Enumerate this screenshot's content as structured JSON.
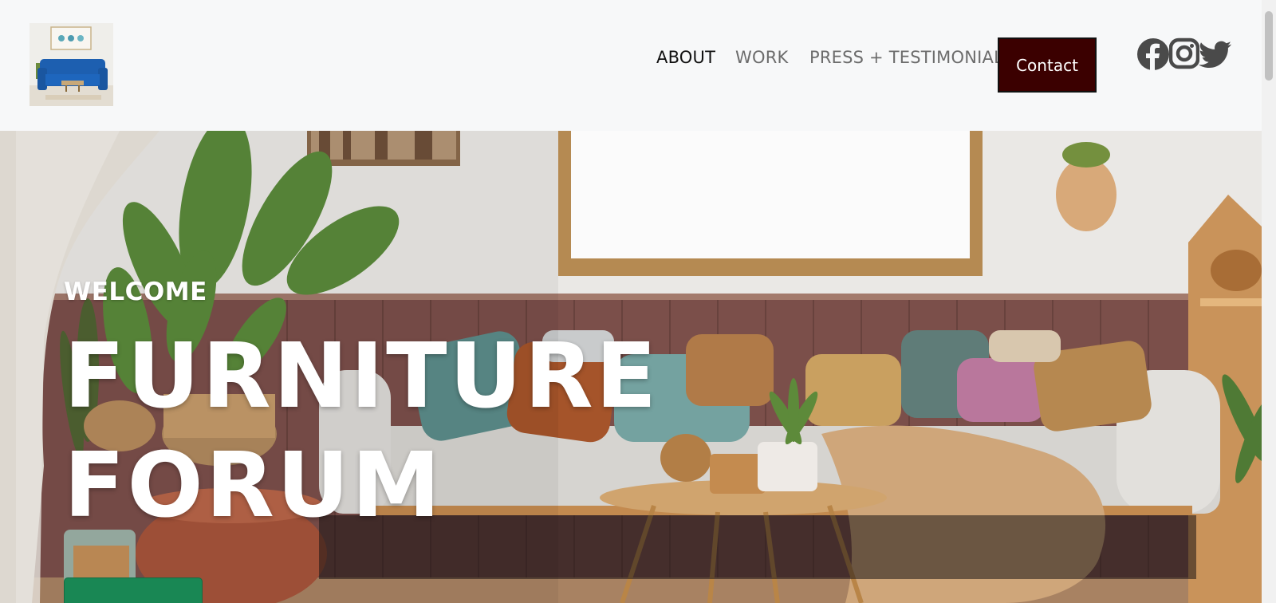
{
  "header": {
    "logo_alt": "blue sofa logo",
    "nav": {
      "about": "ABOUT",
      "work": "WORK",
      "press": "PRESS + TESTIMONIAL",
      "contact": "Contact"
    },
    "social": [
      "facebook-icon",
      "instagram-icon",
      "twitter-icon"
    ]
  },
  "hero": {
    "welcome": "WELCOME",
    "title_line1": "FURNITURE",
    "title_line2": "FORUM",
    "cta_label": ""
  },
  "colors": {
    "header_bg": "#f7f8f9",
    "contact_bg": "#3b0000",
    "cta_bg": "#198754",
    "nav_active": "#111111",
    "nav_inactive": "#6c6c6c"
  }
}
